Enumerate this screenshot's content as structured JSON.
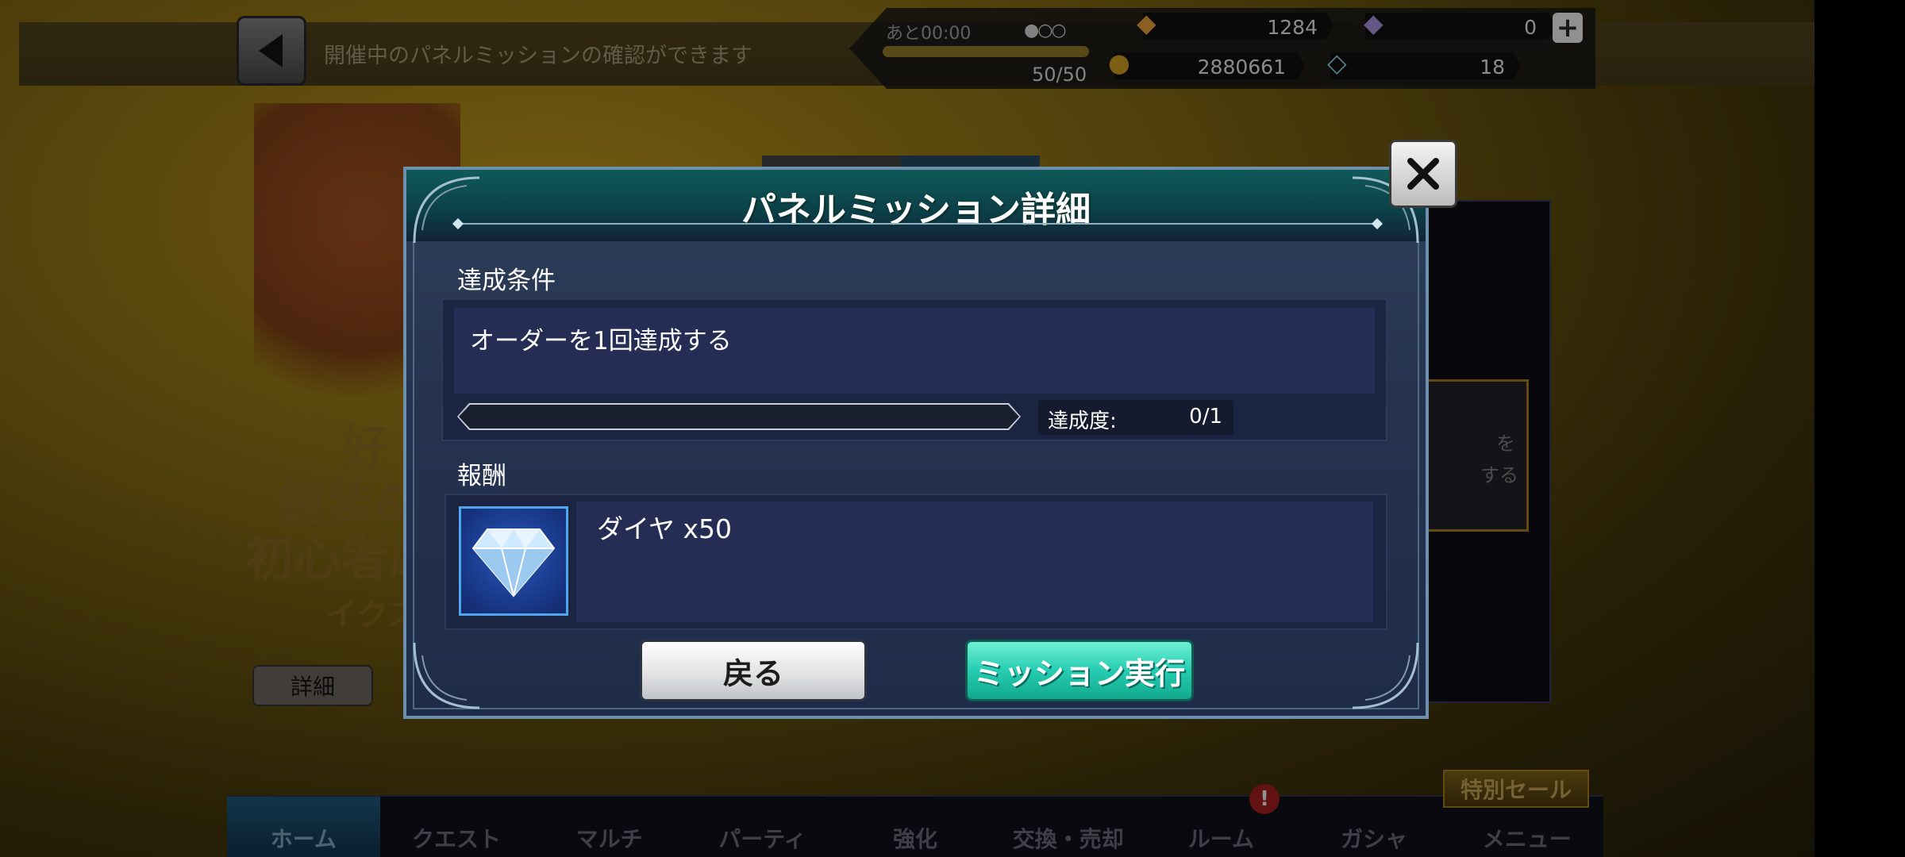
{
  "header": {
    "hint": "開催中のパネルミッションの確認ができます",
    "stamina_timer": "あと00:00",
    "stamina_count": "50/50",
    "resources": [
      {
        "icon": "crystal-icon",
        "value": "1284"
      },
      {
        "icon": "purple-crystal-icon",
        "value": "0"
      },
      {
        "icon": "gald-coin-icon",
        "value": "2880661"
      },
      {
        "icon": "diamond-icon",
        "value": "18"
      }
    ],
    "plus_label": "+"
  },
  "background": {
    "banner_lines": [
      "好",
      "鏡装&",
      "初心者応",
      "イクス"
    ],
    "detail_button": "詳細",
    "right_card_lines": [
      "を",
      "する"
    ]
  },
  "modal": {
    "title": "パネルミッション詳細",
    "condition_label": "達成条件",
    "condition_text": "オーダーを1回達成する",
    "progress": {
      "current": 0,
      "total": 1
    },
    "rate_label": "達成度:",
    "rate_value": "0/1",
    "reward_label": "報酬",
    "reward_icon": "diamond-icon",
    "reward_text": "ダイヤ x50",
    "back_button": "戻る",
    "execute_button": "ミッション実行"
  },
  "nav": {
    "items": [
      "ホーム",
      "クエスト",
      "マルチ",
      "パーティ",
      "強化",
      "交換・売却",
      "ルーム",
      "ガシャ",
      "メニュー"
    ],
    "active_index": 0,
    "room_badge": "!",
    "sale_tag": "特別セール"
  },
  "colors": {
    "accent_teal": "#26cdb2",
    "modal_bg": "#253350",
    "progress_fill": "#57c6e0"
  }
}
